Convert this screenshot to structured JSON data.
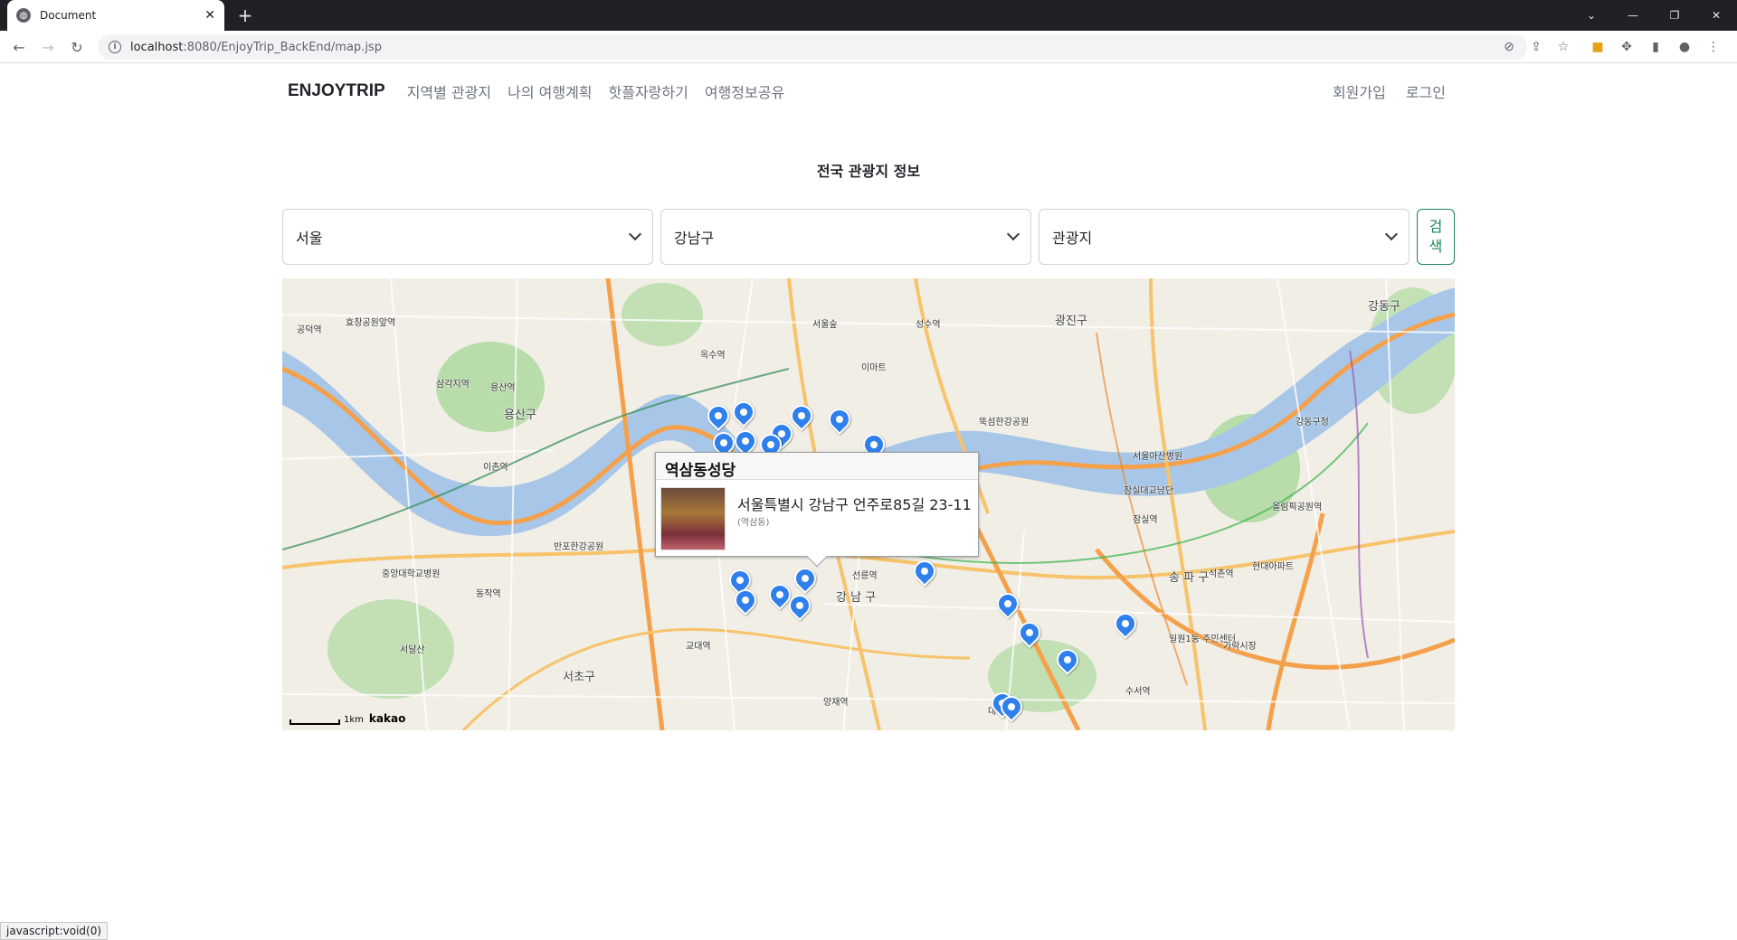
{
  "browser": {
    "tab_title": "Document",
    "url_host": "localhost",
    "url_rest": ":8080/EnjoyTrip_BackEnd/map.jsp",
    "status_text": "javascript:void(0)"
  },
  "nav": {
    "brand": "ENJOYTRIP",
    "links": [
      "지역별 관광지",
      "나의 여행계획",
      "핫플자랑하기",
      "여행정보공유"
    ],
    "signup": "회원가입",
    "login": "로그인"
  },
  "page_title": "전국 관광지 정보",
  "filters": {
    "sido": "서울",
    "gugun": "강남구",
    "content_type": "관광지",
    "search_label": "검색"
  },
  "map": {
    "labels": {
      "l1": "용산구",
      "l2": "강 남 구",
      "l3": "서초구",
      "l4": "송 파 구",
      "l5": "강동구청",
      "l6": "이촌역",
      "l7": "반포한강공원",
      "l8": "잠실역",
      "l9": "올림픽공원역",
      "l10": "가락시장",
      "l11": "석촌역",
      "l12": "교대역",
      "l13": "양재역",
      "l14": "수서역",
      "l15": "선릉역",
      "l16": "성수역",
      "l17": "용산역",
      "l18": "서울숲",
      "l19": "이마트",
      "l20": "광진구",
      "l21": "강동구",
      "l22": "동작역",
      "l23": "중앙대학교병원",
      "l24": "서울아산병원",
      "l25": "현대아파트",
      "l26": "서달산",
      "l27": "대모산",
      "l28": "일원1동 주민센터",
      "l29": "잠실대교남단",
      "l30": "뚝섬한강공원",
      "l31": "옥수역",
      "l32": "삼각지역",
      "l33": "효창공원앞역",
      "l34": "공덕역"
    },
    "info_window": {
      "title": "역삼동성당",
      "address": "서울특별시 강남구 언주로85길 23-11",
      "jibun": "(역삼동)"
    },
    "scale_label": "1km",
    "logo": "kakao"
  }
}
